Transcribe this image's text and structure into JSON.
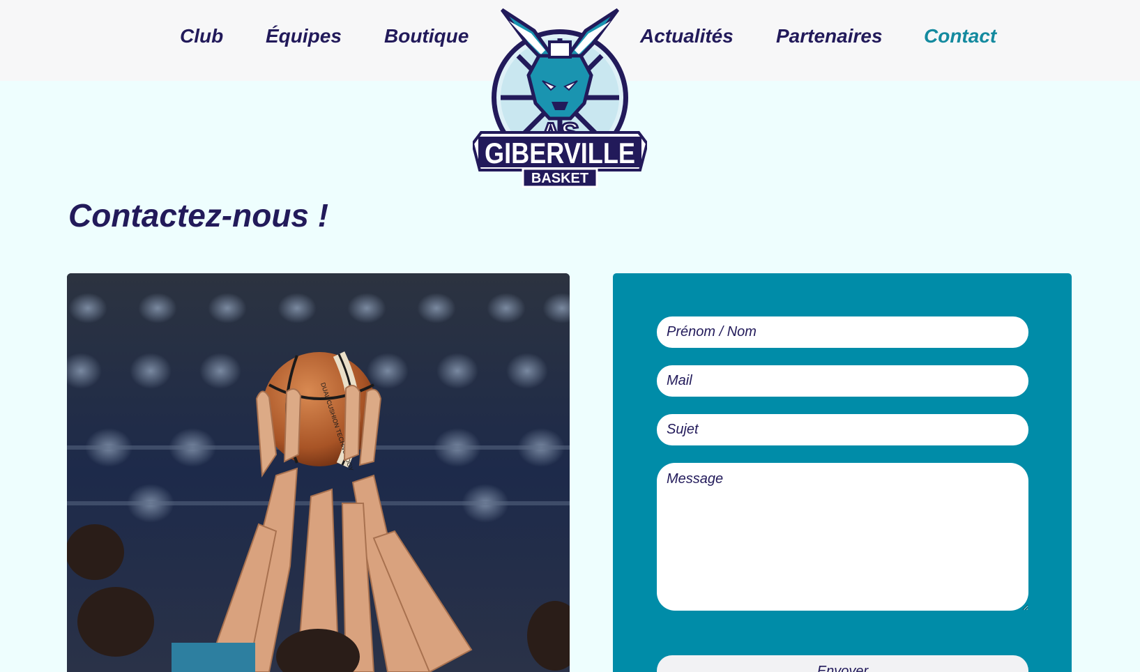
{
  "nav": {
    "items": [
      {
        "label": "Club"
      },
      {
        "label": "Équipes"
      },
      {
        "label": "Boutique"
      },
      {
        "label": "Actualités"
      },
      {
        "label": "Partenaires"
      },
      {
        "label": "Contact",
        "active": true
      }
    ]
  },
  "logo": {
    "line1": "AS",
    "line2": "GIBERVILLE",
    "line3": "BASKET",
    "icon": "kangaroo-basketball-logo"
  },
  "page": {
    "title": "Contactez-nous !"
  },
  "photo": {
    "ball_text": "DUAL CUSHION TECHNOLOGY"
  },
  "form": {
    "name_placeholder": "Prénom / Nom",
    "mail_placeholder": "Mail",
    "subject_placeholder": "Sujet",
    "message_placeholder": "Message",
    "submit_label": "Envoyer"
  },
  "colors": {
    "background": "#eefefe",
    "header": "#f7f7f8",
    "navy": "#221a5a",
    "teal": "#148a9f",
    "form_panel": "#008ca8"
  }
}
